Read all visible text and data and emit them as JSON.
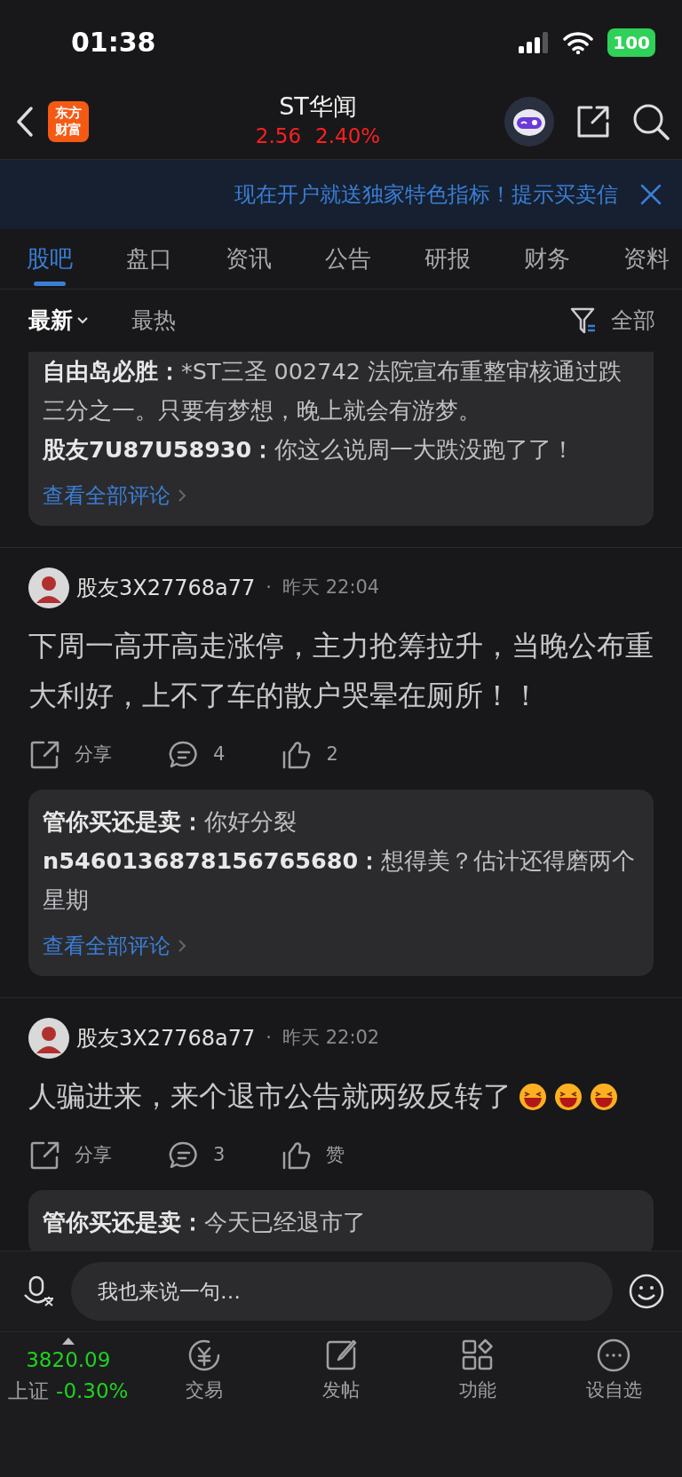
{
  "status_bar": {
    "time": "01:38",
    "battery": "100"
  },
  "header": {
    "logo_lines": [
      "东方",
      "财富"
    ],
    "title": "ST华闻",
    "price": "2.56",
    "change": "2.40%"
  },
  "banner": {
    "text": "现在开户就送独家特色指标！提示买卖信"
  },
  "tabs": [
    {
      "label": "股吧",
      "selected": true
    },
    {
      "label": "盘口",
      "selected": false
    },
    {
      "label": "资讯",
      "selected": false
    },
    {
      "label": "公告",
      "selected": false
    },
    {
      "label": "研报",
      "selected": false
    },
    {
      "label": "财务",
      "selected": false
    },
    {
      "label": "资料",
      "selected": false
    }
  ],
  "sort_options": [
    {
      "label": "最新",
      "selected": true
    },
    {
      "label": "最热",
      "selected": false
    }
  ],
  "filter": {
    "label": "全部"
  },
  "posts": [
    {
      "replies": [
        {
          "user": "自由岛必胜：",
          "text": "*ST三圣 002742  法院宣布重整审核通过跌三分之一。只要有梦想，晚上就会有游梦。"
        },
        {
          "user": "股友7U87U58930：",
          "text": "你这么说周一大跌没跑了了！"
        }
      ],
      "more_link": "查看全部评论"
    },
    {
      "author": "股友3X27768a77",
      "separator": "·",
      "time": "昨天 22:04",
      "text": "下周一高开高走涨停，主力抢筹拉升，当晚公布重大利好，上不了车的散户哭晕在厕所！！",
      "share": "分享",
      "comments": "4",
      "likes": "2",
      "replies": [
        {
          "user": "管你买还是卖：",
          "text": "你好分裂"
        },
        {
          "user": "n5460136878156765680：",
          "text": "想得美？估计还得磨两个星期"
        }
      ],
      "more_link": "查看全部评论"
    },
    {
      "author": "股友3X27768a77",
      "separator": "·",
      "time": "昨天 22:02",
      "text": "人骗进来，来个退市公告就两级反转了",
      "emoji_icons": [
        {
          "kind": "laughing-face"
        },
        {
          "kind": "laughing-face"
        },
        {
          "kind": "laughing-face"
        }
      ],
      "share": "分享",
      "comments": "3",
      "likes": "赞",
      "replies": [
        {
          "user": "管你买还是卖：",
          "text": "今天已经退市了"
        }
      ]
    }
  ],
  "comment_input": {
    "placeholder": "我也来说一句…"
  },
  "bottom_bar": {
    "index_value": "3820.09",
    "index_name": "上证",
    "index_change": "-0.30%",
    "items": [
      {
        "kind": "trade",
        "label": "交易"
      },
      {
        "kind": "post",
        "label": "发帖"
      },
      {
        "kind": "features",
        "label": "功能"
      },
      {
        "kind": "more",
        "label": "设自选"
      }
    ]
  }
}
